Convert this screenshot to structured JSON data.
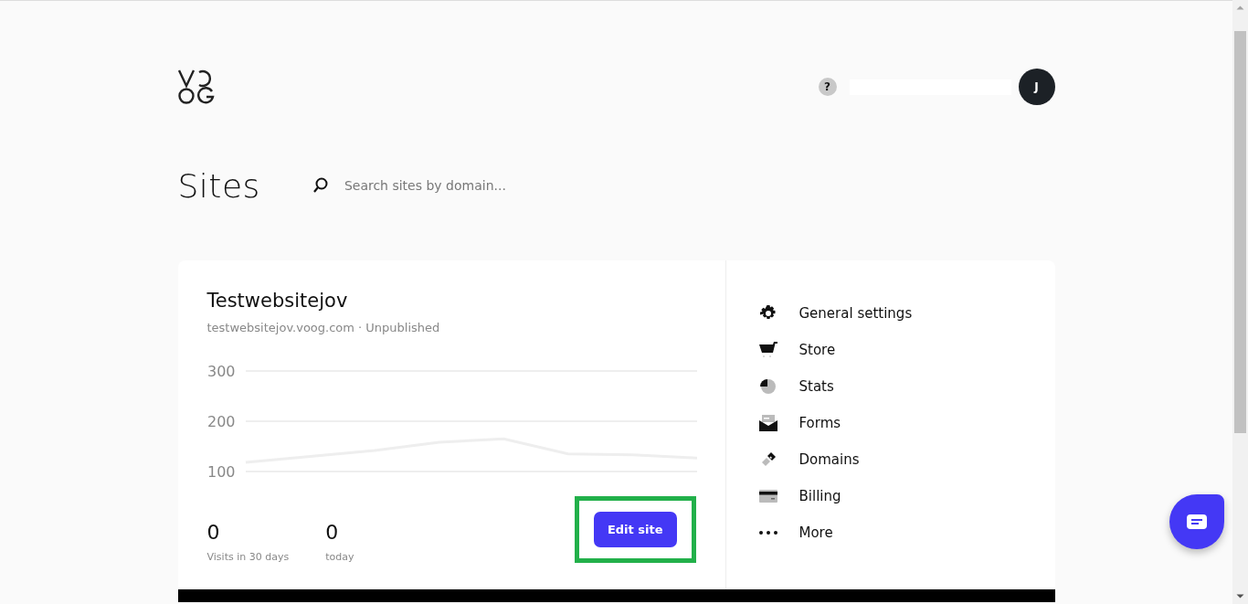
{
  "header": {
    "help": "?",
    "avatar": "J"
  },
  "page": {
    "title": "Sites",
    "search": {
      "placeholder": "Search sites by domain..."
    }
  },
  "site": {
    "name": "Testwebsitejov",
    "domain": "testwebsitejov.voog.com",
    "separator": "·",
    "status": "Unpublished",
    "chart_data": {
      "type": "line",
      "yticks": [
        100,
        200,
        300
      ],
      "ylim": [
        100,
        300
      ],
      "series": [
        {
          "color": "#eeeeee",
          "values": [
            118,
            130,
            142,
            158,
            165,
            135,
            133,
            127
          ]
        }
      ]
    },
    "stats": [
      {
        "value": "0",
        "label": "Visits in 30 days"
      },
      {
        "value": "0",
        "label": "today"
      }
    ],
    "edit_button": {
      "label": "Edit site",
      "highlighted": true
    }
  },
  "menu": [
    {
      "kind": "gear",
      "label": "General settings"
    },
    {
      "kind": "cart",
      "label": "Store"
    },
    {
      "kind": "pie",
      "label": "Stats"
    },
    {
      "kind": "mail",
      "label": "Forms"
    },
    {
      "kind": "link",
      "label": "Domains"
    },
    {
      "kind": "card",
      "label": "Billing"
    },
    {
      "kind": "dots",
      "label": "More"
    }
  ]
}
